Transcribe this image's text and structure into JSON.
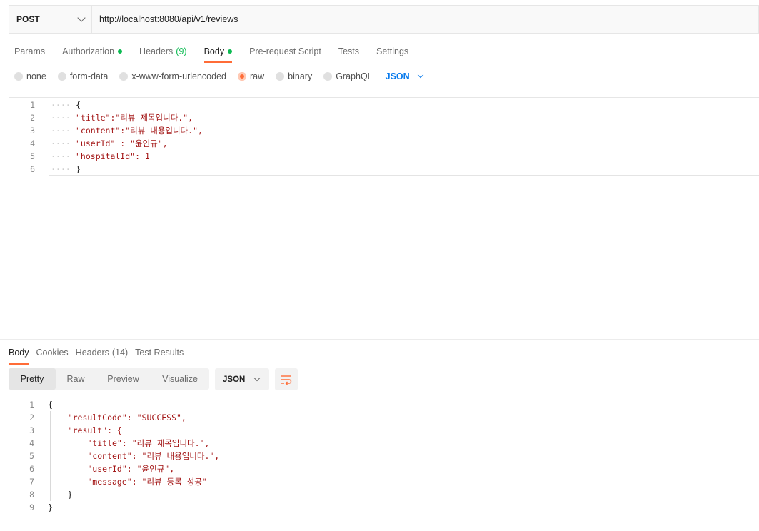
{
  "request": {
    "method": "POST",
    "url": "http://localhost:8080/api/v1/reviews"
  },
  "request_tabs": [
    {
      "label": "Params",
      "dot": false,
      "count": ""
    },
    {
      "label": "Authorization",
      "dot": true,
      "count": ""
    },
    {
      "label": "Headers",
      "dot": false,
      "count": "(9)"
    },
    {
      "label": "Body",
      "dot": true,
      "count": "",
      "active": true
    },
    {
      "label": "Pre-request Script",
      "dot": false,
      "count": ""
    },
    {
      "label": "Tests",
      "dot": false,
      "count": ""
    },
    {
      "label": "Settings",
      "dot": false,
      "count": ""
    }
  ],
  "body_types": [
    "none",
    "form-data",
    "x-www-form-urlencoded",
    "raw",
    "binary",
    "GraphQL"
  ],
  "selected_body_type": "raw",
  "raw_format": "JSON",
  "request_body_lines": [
    "{",
    "\"title\":\"리뷰 제목입니다.\",",
    "\"content\":\"리뷰 내용입니다.\",",
    "\"userId\" : \"윤인규\",",
    "\"hospitalId\": 1",
    "}"
  ],
  "response_tabs": [
    {
      "label": "Body",
      "count": "",
      "active": true
    },
    {
      "label": "Cookies",
      "count": ""
    },
    {
      "label": "Headers",
      "count": "(14)"
    },
    {
      "label": "Test Results",
      "count": ""
    }
  ],
  "view_modes": [
    "Pretty",
    "Raw",
    "Preview",
    "Visualize"
  ],
  "active_view_mode": "Pretty",
  "response_format": "JSON",
  "response_body_lines": [
    "{",
    "    \"resultCode\": \"SUCCESS\",",
    "    \"result\": {",
    "        \"title\": \"리뷰 제목입니다.\",",
    "        \"content\": \"리뷰 내용입니다.\",",
    "        \"userId\": \"윤인규\",",
    "        \"message\": \"리뷰 등록 성공\"",
    "    }",
    "}"
  ],
  "colors": {
    "accent": "#ff6c37",
    "success_dot": "#0cbb52",
    "link_blue": "#097bed"
  }
}
